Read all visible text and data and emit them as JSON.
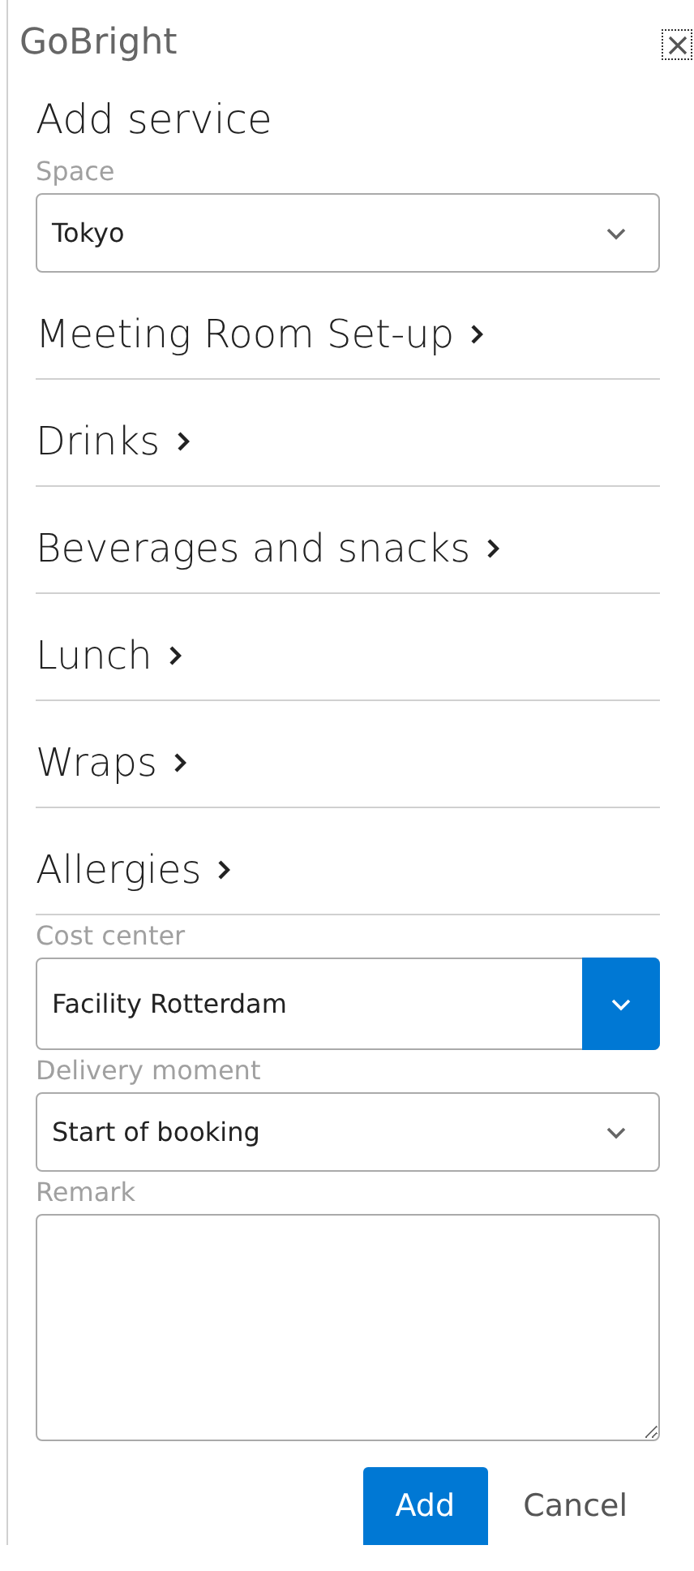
{
  "app_title": "GoBright",
  "heading": "Add service",
  "space": {
    "label": "Space",
    "value": "Tokyo"
  },
  "categories": [
    {
      "label": "Meeting Room Set-up"
    },
    {
      "label": "Drinks"
    },
    {
      "label": "Beverages and snacks"
    },
    {
      "label": "Lunch"
    },
    {
      "label": "Wraps"
    },
    {
      "label": "Allergies"
    }
  ],
  "fields": [
    {
      "kind": "combo",
      "label": "Cost center",
      "value": "Facility Rotterdam"
    },
    {
      "kind": "select",
      "label": "Delivery moment",
      "value": "Start of booking"
    },
    {
      "kind": "textarea",
      "label": "Remark"
    }
  ],
  "buttons": [
    {
      "kind": "primary",
      "label": "Add"
    },
    {
      "kind": "link",
      "label": "Cancel"
    }
  ]
}
